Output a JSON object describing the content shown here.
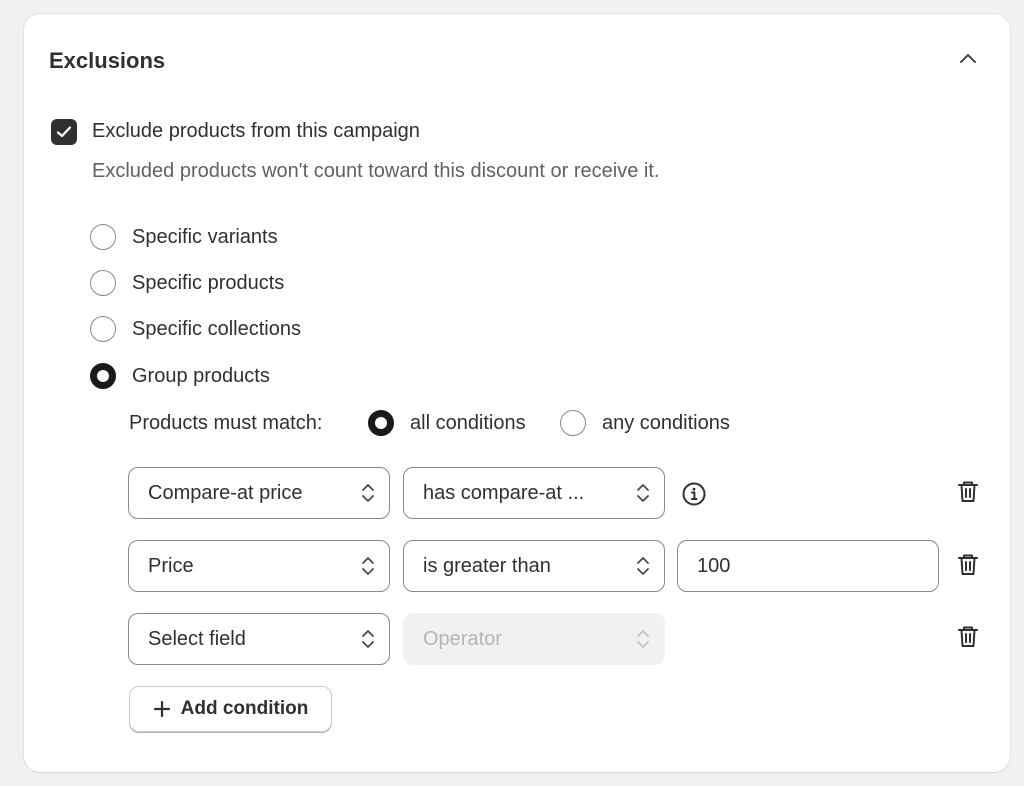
{
  "card": {
    "title": "Exclusions"
  },
  "exclude": {
    "checked": true,
    "label": "Exclude products from this campaign",
    "help": "Excluded products won't count toward this discount or receive it."
  },
  "scope_options": [
    {
      "label": "Specific variants",
      "selected": false
    },
    {
      "label": "Specific products",
      "selected": false
    },
    {
      "label": "Specific collections",
      "selected": false
    },
    {
      "label": "Group products",
      "selected": true
    }
  ],
  "match": {
    "label": "Products must match:",
    "options": [
      {
        "label": "all conditions",
        "selected": true
      },
      {
        "label": "any conditions",
        "selected": false
      }
    ]
  },
  "conditions": [
    {
      "field": "Compare-at price",
      "operator": "has compare-at ...",
      "value": null,
      "info_icon": "info-icon"
    },
    {
      "field": "Price",
      "operator": "is greater than",
      "value": "100"
    },
    {
      "field": "Select field",
      "operator": "Operator",
      "operator_disabled": true,
      "value": null
    }
  ],
  "add_condition_label": "Add condition",
  "icons": {
    "collapse": "chevron-up-icon",
    "checkmark": "checkmark-icon",
    "select_arrows": "select-chevrons-icon",
    "info": "info-icon",
    "delete": "trash-icon",
    "add": "plus-icon"
  },
  "colors": {
    "checkbox_fill": "#303030",
    "disabled_field": "#f1f1f1",
    "card_background": "#ffffff",
    "page_background": "#f1f1f1"
  }
}
